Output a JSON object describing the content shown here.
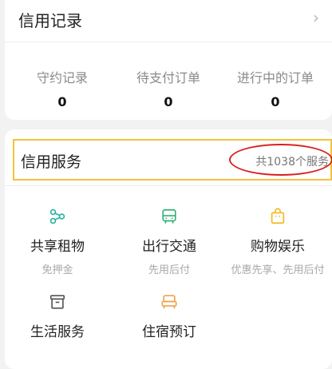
{
  "records": {
    "title": "信用记录",
    "chevron": "›",
    "stats": [
      {
        "label": "守约记录",
        "value": "0"
      },
      {
        "label": "待支付订单",
        "value": "0"
      },
      {
        "label": "进行中的订单",
        "value": "0"
      }
    ]
  },
  "services": {
    "title": "信用服务",
    "count_text": "共1038个服务",
    "items": [
      {
        "name": "共享租物",
        "sub": "免押金",
        "icon": "share-nodes-icon"
      },
      {
        "name": "出行交通",
        "sub": "先用后付",
        "icon": "bus-icon"
      },
      {
        "name": "购物娱乐",
        "sub": "优惠先享、先用后付",
        "icon": "shopping-bag-icon"
      },
      {
        "name": "生活服务",
        "sub": "",
        "icon": "archive-box-icon"
      },
      {
        "name": "住宿预订",
        "sub": "",
        "icon": "bed-icon"
      }
    ]
  },
  "colors": {
    "teal": "#2bb3a3",
    "green": "#35b073",
    "yellow": "#f3b81f",
    "header_border": "#f3c23b",
    "ellipse": "#d9201e"
  }
}
